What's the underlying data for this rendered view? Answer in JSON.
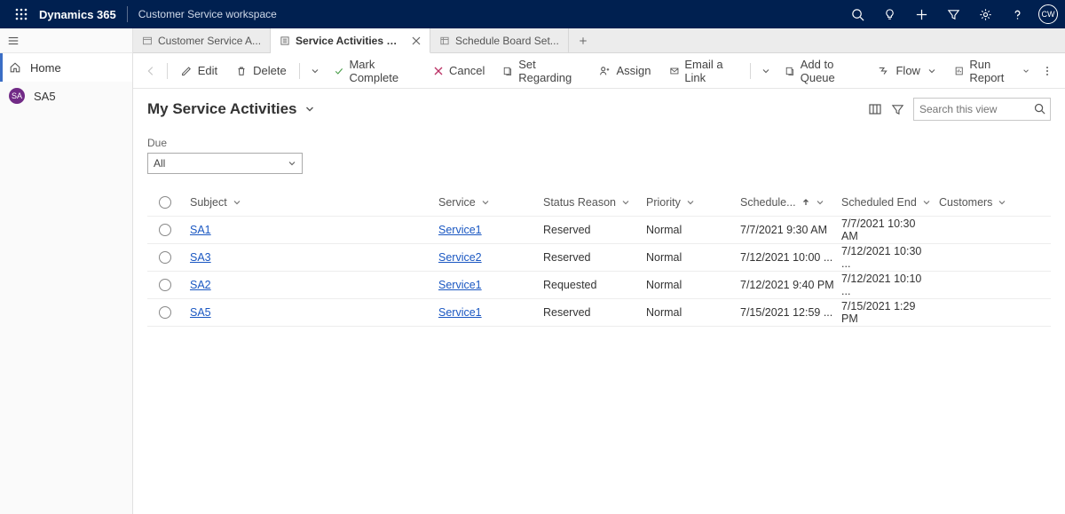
{
  "header": {
    "brand": "Dynamics 365",
    "workspace": "Customer Service workspace",
    "avatar_initials": "CW"
  },
  "sidebar": {
    "home_label": "Home",
    "sa_label": "SA5"
  },
  "tabs": [
    {
      "label": "Customer Service A...",
      "active": false,
      "closable": false
    },
    {
      "label": "Service Activities My Ser...",
      "active": true,
      "closable": true
    },
    {
      "label": "Schedule Board Set...",
      "active": false,
      "closable": false
    }
  ],
  "commands": {
    "edit": "Edit",
    "delete": "Delete",
    "mark_complete": "Mark Complete",
    "cancel": "Cancel",
    "set_regarding": "Set Regarding",
    "assign": "Assign",
    "email_link": "Email a Link",
    "add_to_queue": "Add to Queue",
    "flow": "Flow",
    "run_report": "Run Report"
  },
  "view": {
    "title": "My Service Activities",
    "search_placeholder": "Search this view",
    "due_label": "Due",
    "due_value": "All"
  },
  "columns": {
    "subject": "Subject",
    "service": "Service",
    "status": "Status Reason",
    "priority": "Priority",
    "start": "Schedule...",
    "end": "Scheduled End",
    "customers": "Customers"
  },
  "rows": [
    {
      "subject": "SA1",
      "service": "Service1",
      "status": "Reserved",
      "priority": "Normal",
      "start": "7/7/2021 9:30 AM",
      "end": "7/7/2021 10:30 AM",
      "customers": ""
    },
    {
      "subject": "SA3",
      "service": "Service2",
      "status": "Reserved",
      "priority": "Normal",
      "start": "7/12/2021 10:00 ...",
      "end": "7/12/2021 10:30 ...",
      "customers": ""
    },
    {
      "subject": "SA2",
      "service": "Service1",
      "status": "Requested",
      "priority": "Normal",
      "start": "7/12/2021 9:40 PM",
      "end": "7/12/2021 10:10 ...",
      "customers": ""
    },
    {
      "subject": "SA5",
      "service": "Service1",
      "status": "Reserved",
      "priority": "Normal",
      "start": "7/15/2021 12:59 ...",
      "end": "7/15/2021 1:29 PM",
      "customers": ""
    }
  ]
}
